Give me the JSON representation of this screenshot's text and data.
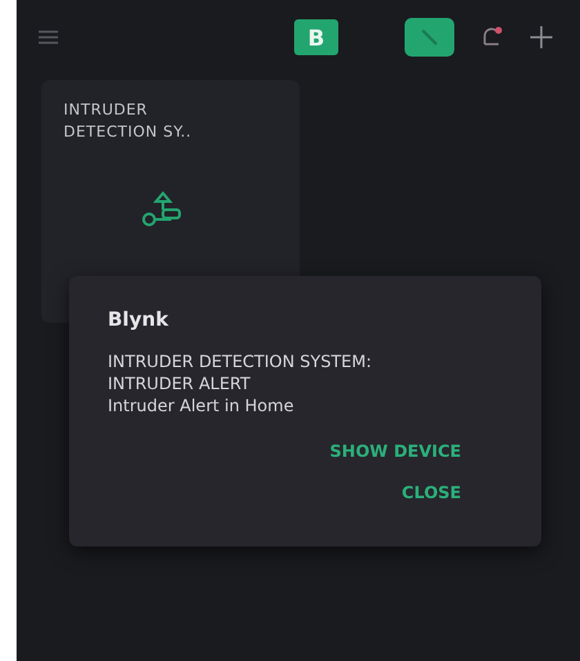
{
  "top_bar": {
    "logo_letter": "B"
  },
  "widget": {
    "title": "INTRUDER DETECTION SY.."
  },
  "dialog": {
    "title": "Blynk",
    "lines": [
      "INTRUDER DETECTION SYSTEM:",
      "INTRUDER ALERT",
      "Intruder Alert in Home"
    ],
    "buttons": [
      "SHOW DEVICE",
      "CLOSE"
    ]
  }
}
